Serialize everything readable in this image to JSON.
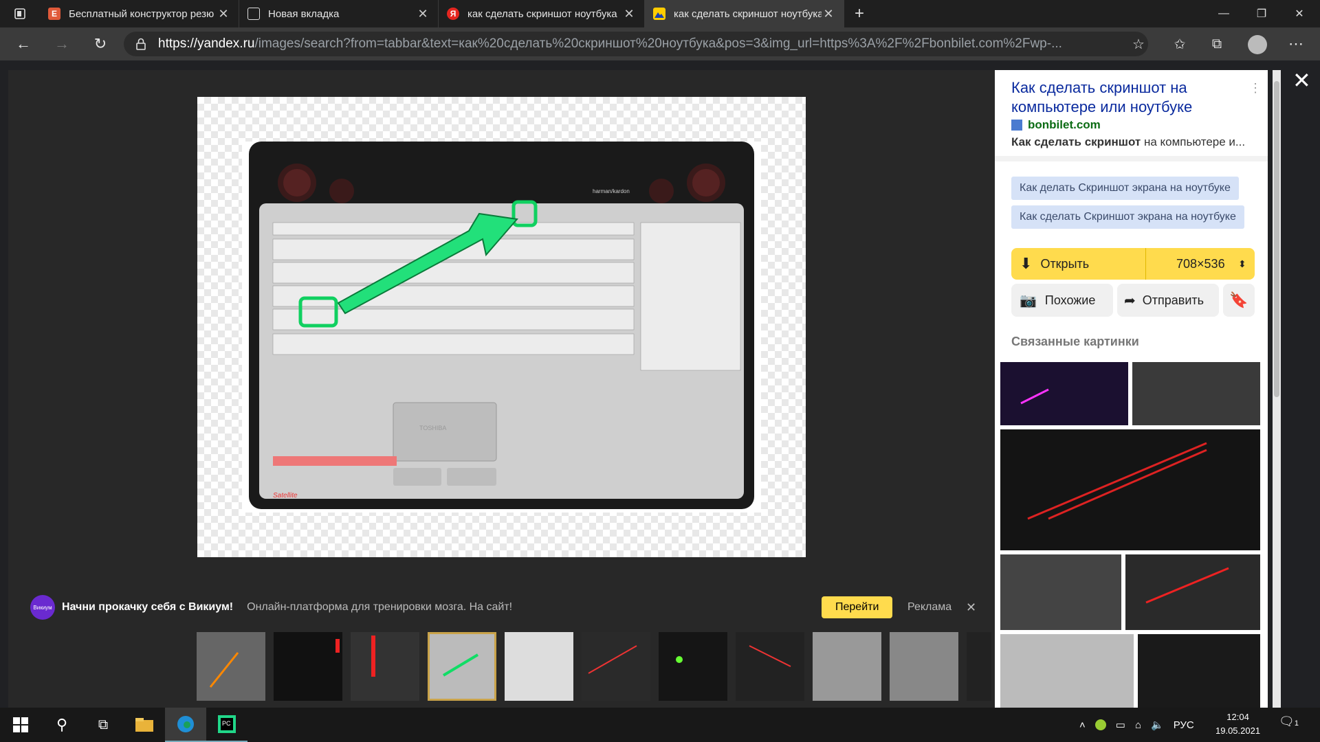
{
  "tabs": [
    {
      "label": "Бесплатный конструктор резю",
      "icon": "resume-icon",
      "color": "#e05a3a"
    },
    {
      "label": "Новая вкладка",
      "icon": "newtab-icon",
      "color": "#ffffff"
    },
    {
      "label": "как сделать скриншот ноутбука",
      "icon": "yandex-icon",
      "color": "#e52620"
    },
    {
      "label": "как сделать скриншот ноутбука",
      "icon": "yandex-images-icon",
      "color": "#ffcc00",
      "active": true
    }
  ],
  "address": {
    "url_host": "https://yandex.ru",
    "url_rest": "/images/search?from=tabbar&text=как%20сделать%20скриншот%20ноутбука&pos=3&img_url=https%3A%2F%2Fbonbilet.com%2Fwp-..."
  },
  "panel": {
    "title": "Как сделать скриншот на компьютере или ноутбуке",
    "site": "bonbilet.com",
    "snippet_bold": "Как сделать скриншот",
    "snippet_rest": " на компьютере и...",
    "chips": [
      "Как делать Скриншот экрана на ноутбуке",
      "Как сделать Скриншот экрана на ноутбуке"
    ],
    "open_label": "Открыть",
    "size_label": "708×536",
    "similar_label": "Похожие",
    "share_label": "Отправить",
    "related_title": "Связанные картинки"
  },
  "ad": {
    "brand": "Викиум",
    "headline": "Начни прокачку себя с Викиум!",
    "text": "Онлайн-платформа для тренировки мозга. На сайт!",
    "go_label": "Перейти",
    "ad_label": "Реклама"
  },
  "image": {
    "speaker_brand": "harman/kardon",
    "touchpad_brand": "TOSHIBA",
    "model": "Satellite"
  },
  "taskbar": {
    "lang": "РУС",
    "time": "12:04",
    "date": "19.05.2021",
    "notif_count": "1"
  }
}
